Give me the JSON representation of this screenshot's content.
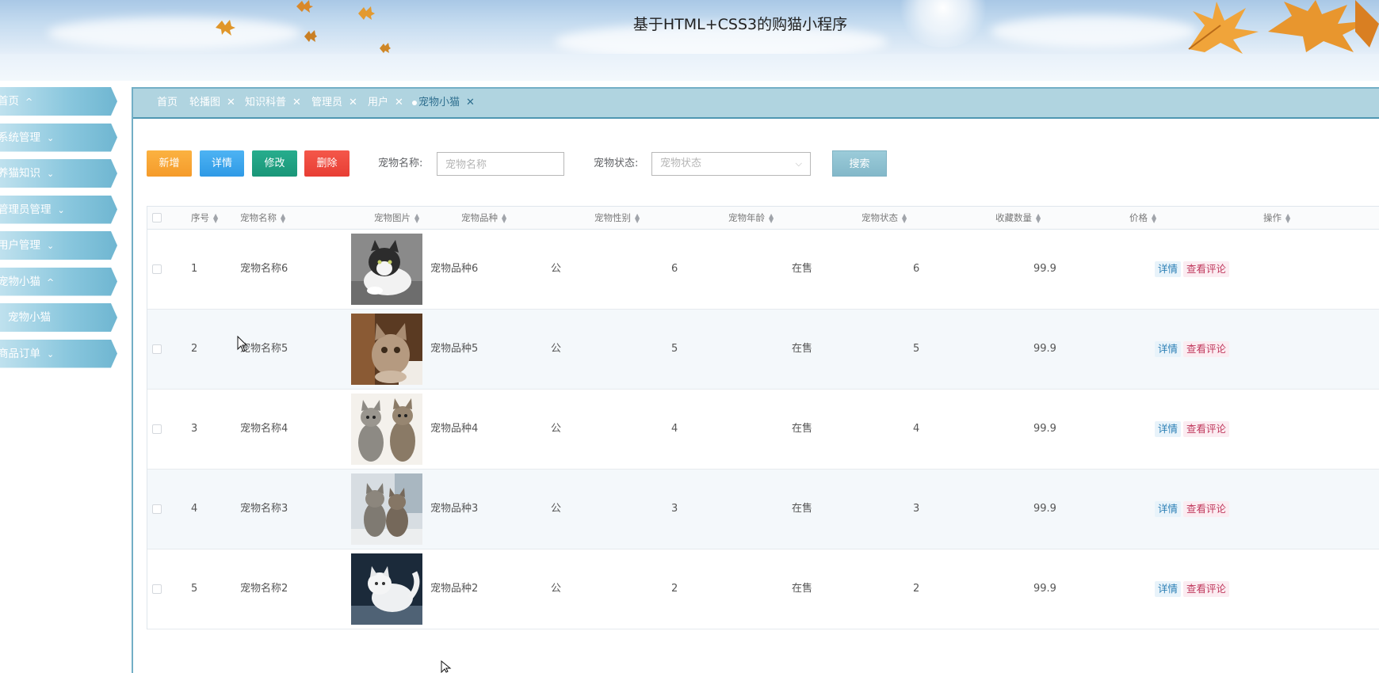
{
  "header": {
    "title": "基于HTML+CSS3的购猫小程序"
  },
  "sidebar": {
    "items": [
      {
        "label": "首页",
        "chevron": "^"
      },
      {
        "label": "系统管理",
        "chevron": "⌄"
      },
      {
        "label": "养猫知识",
        "chevron": "⌄"
      },
      {
        "label": "管理员管理",
        "chevron": "⌄"
      },
      {
        "label": "用户管理",
        "chevron": "⌄"
      },
      {
        "label": "宠物小猫",
        "chevron": "^"
      },
      {
        "label": "宠物小猫",
        "chevron": ""
      },
      {
        "label": "商品订单",
        "chevron": "⌄"
      }
    ]
  },
  "tabs": [
    {
      "label": "首页",
      "closable": false
    },
    {
      "label": "轮播图",
      "closable": true
    },
    {
      "label": "知识科普",
      "closable": true
    },
    {
      "label": "管理员",
      "closable": true
    },
    {
      "label": "用户",
      "closable": true
    },
    {
      "label": "宠物小猫",
      "closable": true,
      "active": true
    }
  ],
  "toolbar": {
    "add_label": "新增",
    "detail_label": "详情",
    "edit_label": "修改",
    "delete_label": "删除",
    "name_label": "宠物名称:",
    "name_placeholder": "宠物名称",
    "status_label": "宠物状态:",
    "status_placeholder": "宠物状态",
    "search_label": "搜索"
  },
  "table": {
    "columns": [
      "序号",
      "宠物名称",
      "宠物图片",
      "宠物品种",
      "宠物性别",
      "宠物年龄",
      "宠物状态",
      "收藏数量",
      "价格",
      "操作"
    ],
    "rows": [
      {
        "index": "1",
        "name": "宠物名称6",
        "breed": "宠物品种6",
        "gender": "公",
        "age": "6",
        "status": "在售",
        "favorites": "6",
        "price": "99.9"
      },
      {
        "index": "2",
        "name": "宠物名称5",
        "breed": "宠物品种5",
        "gender": "公",
        "age": "5",
        "status": "在售",
        "favorites": "5",
        "price": "99.9"
      },
      {
        "index": "3",
        "name": "宠物名称4",
        "breed": "宠物品种4",
        "gender": "公",
        "age": "4",
        "status": "在售",
        "favorites": "4",
        "price": "99.9"
      },
      {
        "index": "4",
        "name": "宠物名称3",
        "breed": "宠物品种3",
        "gender": "公",
        "age": "3",
        "status": "在售",
        "favorites": "3",
        "price": "99.9"
      },
      {
        "index": "5",
        "name": "宠物名称2",
        "breed": "宠物品种2",
        "gender": "公",
        "age": "2",
        "status": "在售",
        "favorites": "2",
        "price": "99.9"
      }
    ],
    "action_detail": "详情",
    "action_comments": "查看评论"
  },
  "colors": {
    "sidebar_item": "#88c6dd",
    "tab_bar": "#b0d4e0",
    "add_button": "#f5a234",
    "detail_button": "#3aa4ec",
    "edit_button": "#1f9f80",
    "delete_button": "#ec463b",
    "search_button": "#8fc0cf"
  }
}
